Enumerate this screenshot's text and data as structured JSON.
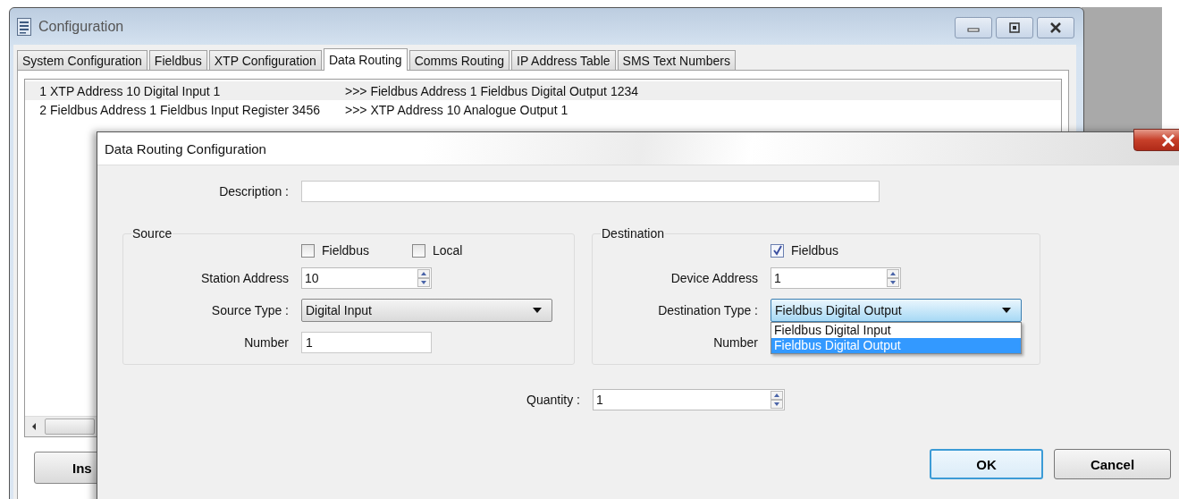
{
  "window": {
    "title": "Configuration"
  },
  "tabs": [
    {
      "label": "System Configuration",
      "selected": false
    },
    {
      "label": "Fieldbus",
      "selected": false
    },
    {
      "label": "XTP Configuration",
      "selected": false
    },
    {
      "label": "Data Routing",
      "selected": true
    },
    {
      "label": "Comms Routing",
      "selected": false
    },
    {
      "label": "IP Address Table",
      "selected": false
    },
    {
      "label": "SMS Text Numbers",
      "selected": false
    }
  ],
  "routes": [
    {
      "index": "1",
      "source": "XTP Address 10 Digital Input 1",
      "destination": ">>> Fieldbus Address 1 Fieldbus Digital Output 1234",
      "selected": true
    },
    {
      "index": "2",
      "source": "Fieldbus Address 1 Fieldbus Input Register 3456",
      "destination": ">>> XTP Address 10 Analogue Output 1",
      "selected": false
    }
  ],
  "insert_button": "Ins",
  "dialog": {
    "title": "Data Routing Configuration",
    "description": {
      "label": "Description :"
    },
    "source": {
      "title": "Source",
      "checkboxes": [
        {
          "label": "Fieldbus",
          "checked": false
        },
        {
          "label": "Local",
          "checked": false
        }
      ],
      "station_address": {
        "label": "Station Address",
        "value": "10"
      },
      "source_type": {
        "label": "Source Type :",
        "value": "Digital Input"
      },
      "number": {
        "label": "Number",
        "value": "1"
      }
    },
    "destination": {
      "title": "Destination",
      "checkboxes": [
        {
          "label": "Fieldbus",
          "checked": true
        }
      ],
      "device_address": {
        "label": "Device Address",
        "value": "1"
      },
      "destination_type": {
        "label": "Destination Type :",
        "value": "Fieldbus Digital Output",
        "expanded": true,
        "options": [
          {
            "label": "Fieldbus Digital Input",
            "selected": false
          },
          {
            "label": "Fieldbus Digital Output",
            "selected": true
          }
        ]
      },
      "number": {
        "label": "Number"
      }
    },
    "quantity": {
      "label": "Quantity :",
      "value": "1"
    },
    "buttons": [
      {
        "label": "OK",
        "default": true
      },
      {
        "label": "Cancel",
        "default": false
      }
    ]
  }
}
